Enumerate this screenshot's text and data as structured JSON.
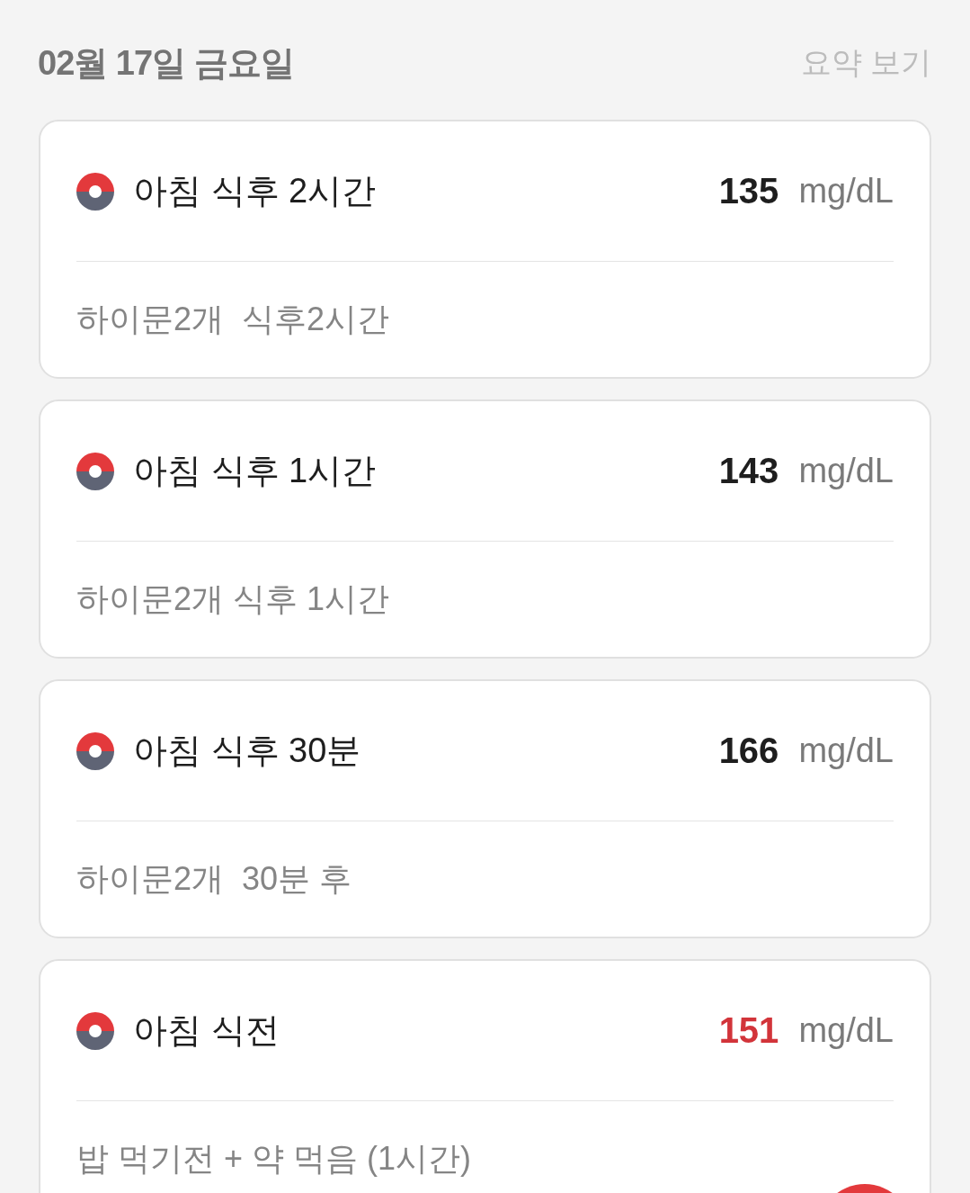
{
  "header": {
    "date": "02월 17일 금요일",
    "summary_link": "요약 보기"
  },
  "readings": [
    {
      "label": "아침 식후 2시간",
      "value": "135",
      "unit": "mg/dL",
      "high": false,
      "note": "하이문2개  식후2시간"
    },
    {
      "label": "아침 식후 1시간",
      "value": "143",
      "unit": "mg/dL",
      "high": false,
      "note": "하이문2개 식후 1시간"
    },
    {
      "label": "아침 식후 30분",
      "value": "166",
      "unit": "mg/dL",
      "high": false,
      "note": "하이문2개  30분 후"
    },
    {
      "label": "아침 식전",
      "value": "151",
      "unit": "mg/dL",
      "high": true,
      "note": "밥 먹기전 + 약 먹음 (1시간)"
    }
  ]
}
